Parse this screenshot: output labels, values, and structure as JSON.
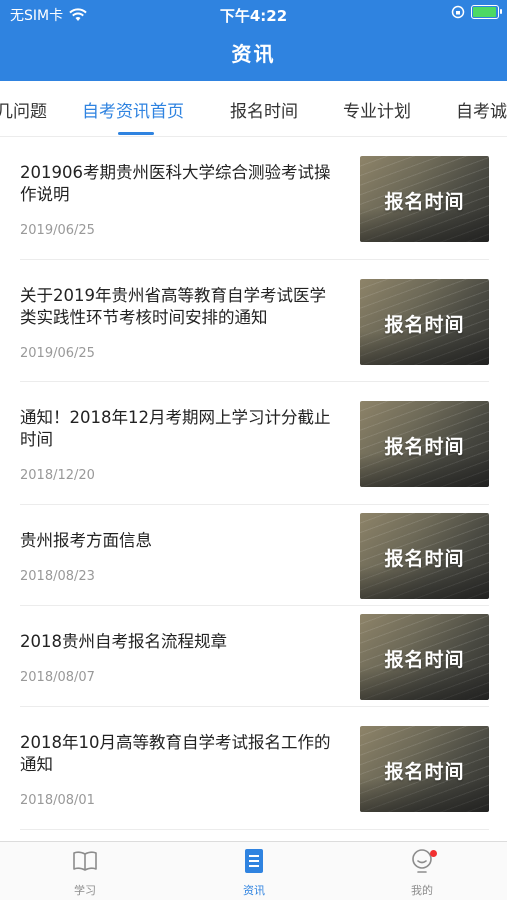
{
  "status_bar": {
    "carrier": "无SIM卡",
    "time": "下午4:22",
    "battery_level": 0.95,
    "battery_color": "#4cd964"
  },
  "nav": {
    "title": "资讯",
    "bar_color": "#2f83e0"
  },
  "tabs": [
    {
      "label": "几问题",
      "active": false
    },
    {
      "label": "自考资讯首页",
      "active": true
    },
    {
      "label": "报名时间",
      "active": false
    },
    {
      "label": "专业计划",
      "active": false
    },
    {
      "label": "自考诚",
      "active": false
    }
  ],
  "news": [
    {
      "title": "201906考期贵州医科大学综合测验考试操作说明",
      "date": "2019/06/25",
      "thumb_label": "报名时间"
    },
    {
      "title": "关于2019年贵州省高等教育自学考试医学类实践性环节考核时间安排的通知",
      "date": "2019/06/25",
      "thumb_label": "报名时间"
    },
    {
      "title": "通知！2018年12月考期网上学习计分截止时间",
      "date": "2018/12/20",
      "thumb_label": "报名时间"
    },
    {
      "title": "贵州报考方面信息",
      "date": "2018/08/23",
      "thumb_label": "报名时间"
    },
    {
      "title": "2018贵州自考报名流程规章",
      "date": "2018/08/07",
      "thumb_label": "报名时间"
    },
    {
      "title": "2018年10月高等教育自学考试报名工作的通知",
      "date": "2018/08/01",
      "thumb_label": "报名时间"
    }
  ],
  "tabbar": [
    {
      "label": "学习",
      "icon": "book-icon",
      "active": false
    },
    {
      "label": "资讯",
      "icon": "document-icon",
      "active": true
    },
    {
      "label": "我的",
      "icon": "bulb-icon",
      "active": false,
      "badge": true
    }
  ]
}
